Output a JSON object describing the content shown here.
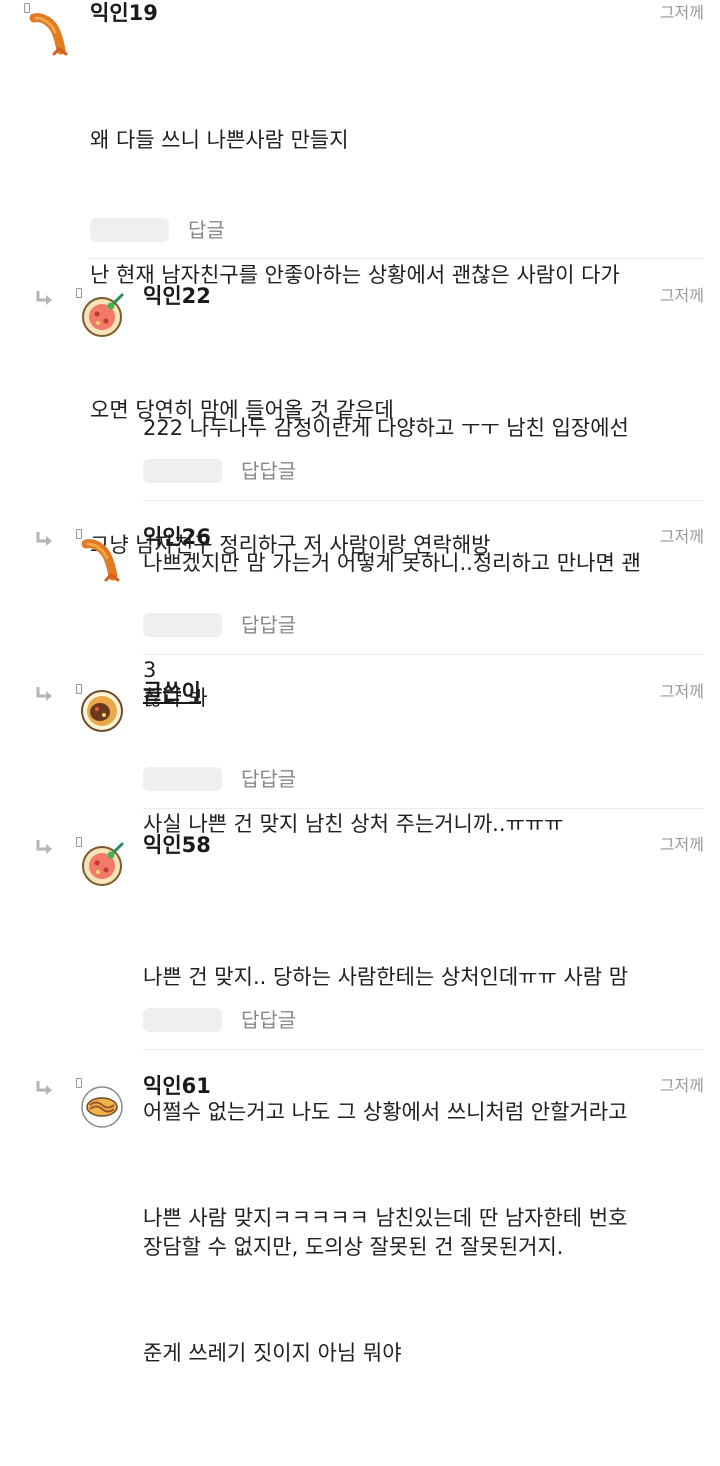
{
  "comments": [
    {
      "name": "익인19",
      "time": "그저께",
      "lines": [
        "왜 다들 쓰니 나쁜사람 만들지",
        "난 현재 남자친구를 안좋아하는 상황에서 괜찮은 사람이 다가",
        "오면 당연히 맘에 들어올 것 같은데",
        "그냥 남자친구 정리하구 저 사람이랑 연락해방"
      ],
      "reply_label": "답글",
      "avatar": "shrimp-icon"
    },
    {
      "name": "익인22",
      "time": "그저께",
      "lines": [
        "222 나두나두 감정이란게 다양하고 ㅜㅜ 남친 입장에선",
        "나쁘겠지만 맘 가는거 어떻게 못하니..정리하고 만나면 괜",
        "찮다 봐"
      ],
      "reply_label": "답답글",
      "avatar": "pizza-icon"
    },
    {
      "name": "익인26",
      "time": "그저께",
      "lines": [
        "3"
      ],
      "reply_label": "답답글",
      "avatar": "shrimp-icon"
    },
    {
      "name": "글쓴이",
      "time": "그저께",
      "lines": [
        "사실 나쁜 건 맞지 남친 상처 주는거니까..ㅠㅠㅠ"
      ],
      "reply_label": "답답글",
      "avatar": "curry-icon"
    },
    {
      "name": "익인58",
      "time": "그저께",
      "lines": [
        "나쁜 건 맞지.. 당하는 사람한테는 상처인데ㅠㅠ 사람 맘",
        "어쩔수 없는거고 나도 그 상황에서 쓰니처럼 안할거라고",
        "장담할 수 없지만, 도의상 잘못된 건 잘못된거지."
      ],
      "reply_label": "답답글",
      "avatar": "pizza-icon"
    },
    {
      "name": "익인61",
      "time": "그저께",
      "lines": [
        "나쁜 사람 맞지ㅋㅋㅋㅋㅋ 남친있는데 딴 남자한테 번호",
        "준게 쓰레기 짓이지 아님 뭐야"
      ],
      "reply_label": "",
      "avatar": "taco-icon"
    }
  ]
}
